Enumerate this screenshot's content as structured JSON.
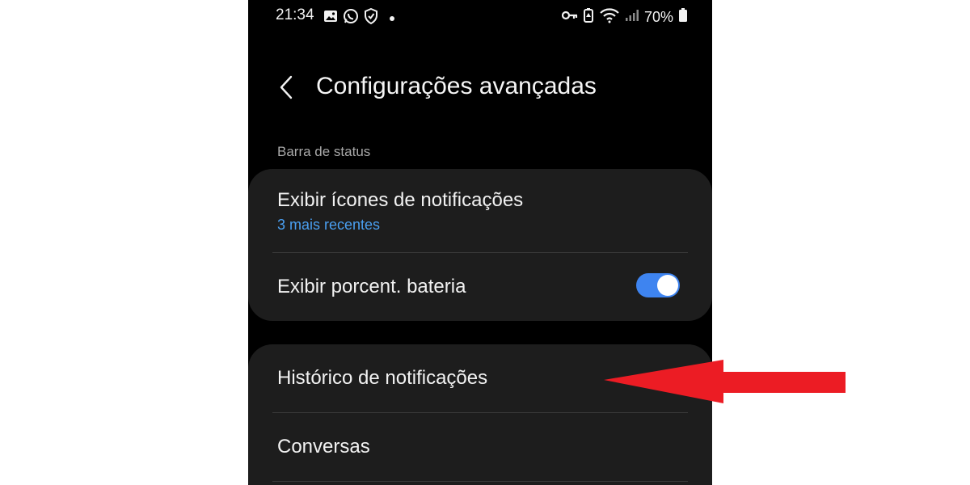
{
  "status_bar": {
    "time": "21:34",
    "battery_percent": "70%",
    "left_icons": [
      "gallery-icon",
      "whatsapp-icon",
      "shield-icon",
      "dot"
    ],
    "right_icons": [
      "key-icon",
      "battery-saver-icon",
      "wifi-icon",
      "signal-icon",
      "battery-icon"
    ]
  },
  "header": {
    "title": "Configurações avançadas"
  },
  "section": {
    "label": "Barra de status"
  },
  "card1": {
    "item1": {
      "title": "Exibir ícones de notificações",
      "subtitle": "3 mais recentes"
    },
    "item2": {
      "title": "Exibir porcent. bateria",
      "toggle_on": true
    }
  },
  "card2": {
    "item1": {
      "title": "Histórico de notificações"
    },
    "item2": {
      "title": "Conversas"
    }
  },
  "colors": {
    "accent": "#3e84f0",
    "link": "#4a9ff0",
    "annotation_arrow": "#ec1c24"
  }
}
